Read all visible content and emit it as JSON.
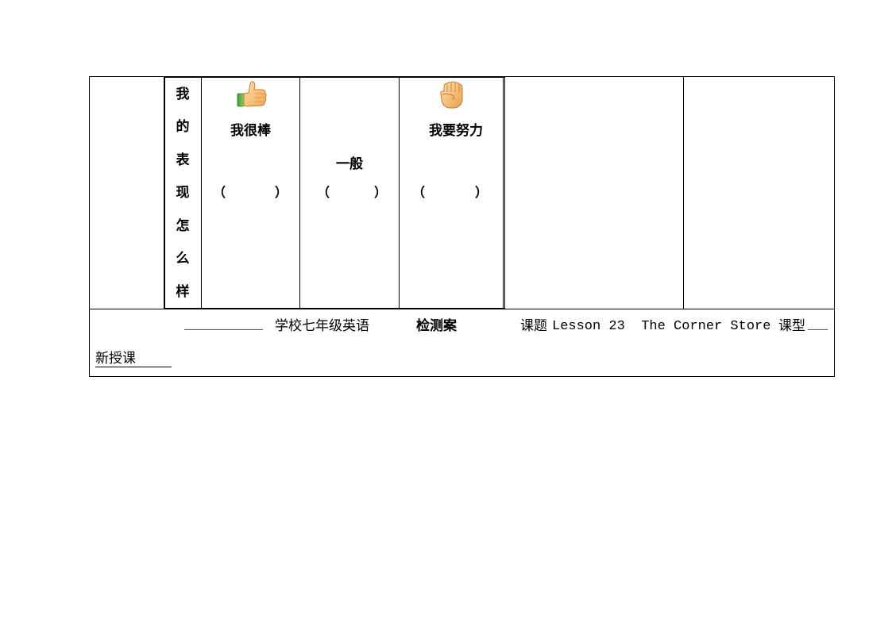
{
  "rating_table": {
    "vertical_label": [
      "我",
      "的",
      "表",
      "现",
      "怎",
      "么",
      "样"
    ],
    "options": [
      {
        "icon": "thumbs-up-icon",
        "label": "我很棒",
        "blank": "（          ）"
      },
      {
        "icon": null,
        "label": "一般",
        "blank": "（          ）"
      },
      {
        "icon": "raised-fist-icon",
        "label": "我要努力",
        "blank": "（          ）"
      }
    ],
    "paren_open": "（",
    "paren_close": "）"
  },
  "footer": {
    "school_blank": "___________",
    "school_suffix": "学校七年级英语",
    "doc_type": "检测案",
    "topic_label": "课题",
    "topic_value": "Lesson 23  The Corner Store",
    "lesson_type_label": "课型",
    "lesson_type_blank": "___",
    "lesson_type_value": "新授课"
  }
}
